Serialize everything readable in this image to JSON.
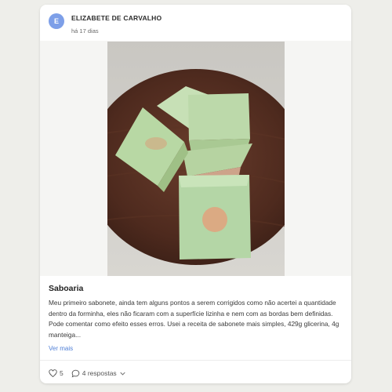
{
  "post": {
    "author_initial": "E",
    "author_name": "ELIZABETE DE CARVALHO",
    "time_ago": "há 17 dias",
    "image_alt": "Sabonetes artesanais verdes sobre base de madeira",
    "title": "Saboaria",
    "body": "Meu primeiro sabonete, ainda tem alguns pontos a serem corrigidos como não acertei a quantidade dentro da forminha, eles não ficaram com a superfície lizinha e nem com as bordas bem definidas. Pode comentar como efeito esses erros. Usei a receita de sabonete mais simples, 429g glicerina, 4g manteiga...",
    "see_more_label": "Ver mais",
    "likes": "5",
    "comments_label": "4 respostas"
  },
  "icons": {
    "like": "heart-icon",
    "comment": "speech-bubble-icon",
    "expand": "chevron-down-icon"
  },
  "colors": {
    "accent": "#4f7fd6",
    "avatar_bg": "#7d9fe8",
    "soap": "#b4d6a6"
  }
}
